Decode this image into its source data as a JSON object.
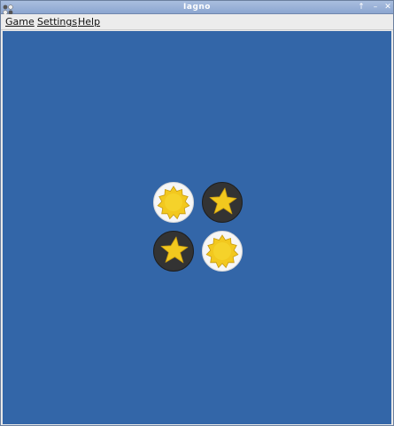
{
  "window": {
    "title": "Iagno",
    "buttons": {
      "maximize_icon": "↑",
      "minimize_icon": "–",
      "close_icon": "✕"
    }
  },
  "menubar": {
    "items": [
      {
        "label": "Game"
      },
      {
        "label": "Settings"
      },
      {
        "label": "Help"
      }
    ]
  },
  "board": {
    "background_color": "#3366a8",
    "pieces": [
      {
        "row": 0,
        "col": 0,
        "player": "light",
        "symbol": "sun"
      },
      {
        "row": 0,
        "col": 1,
        "player": "dark",
        "symbol": "star"
      },
      {
        "row": 1,
        "col": 0,
        "player": "dark",
        "symbol": "star"
      },
      {
        "row": 1,
        "col": 1,
        "player": "light",
        "symbol": "sun"
      }
    ],
    "colors": {
      "light_disc": "#f6f6f6",
      "dark_disc": "#333333",
      "symbol": "#f2c81e"
    }
  }
}
